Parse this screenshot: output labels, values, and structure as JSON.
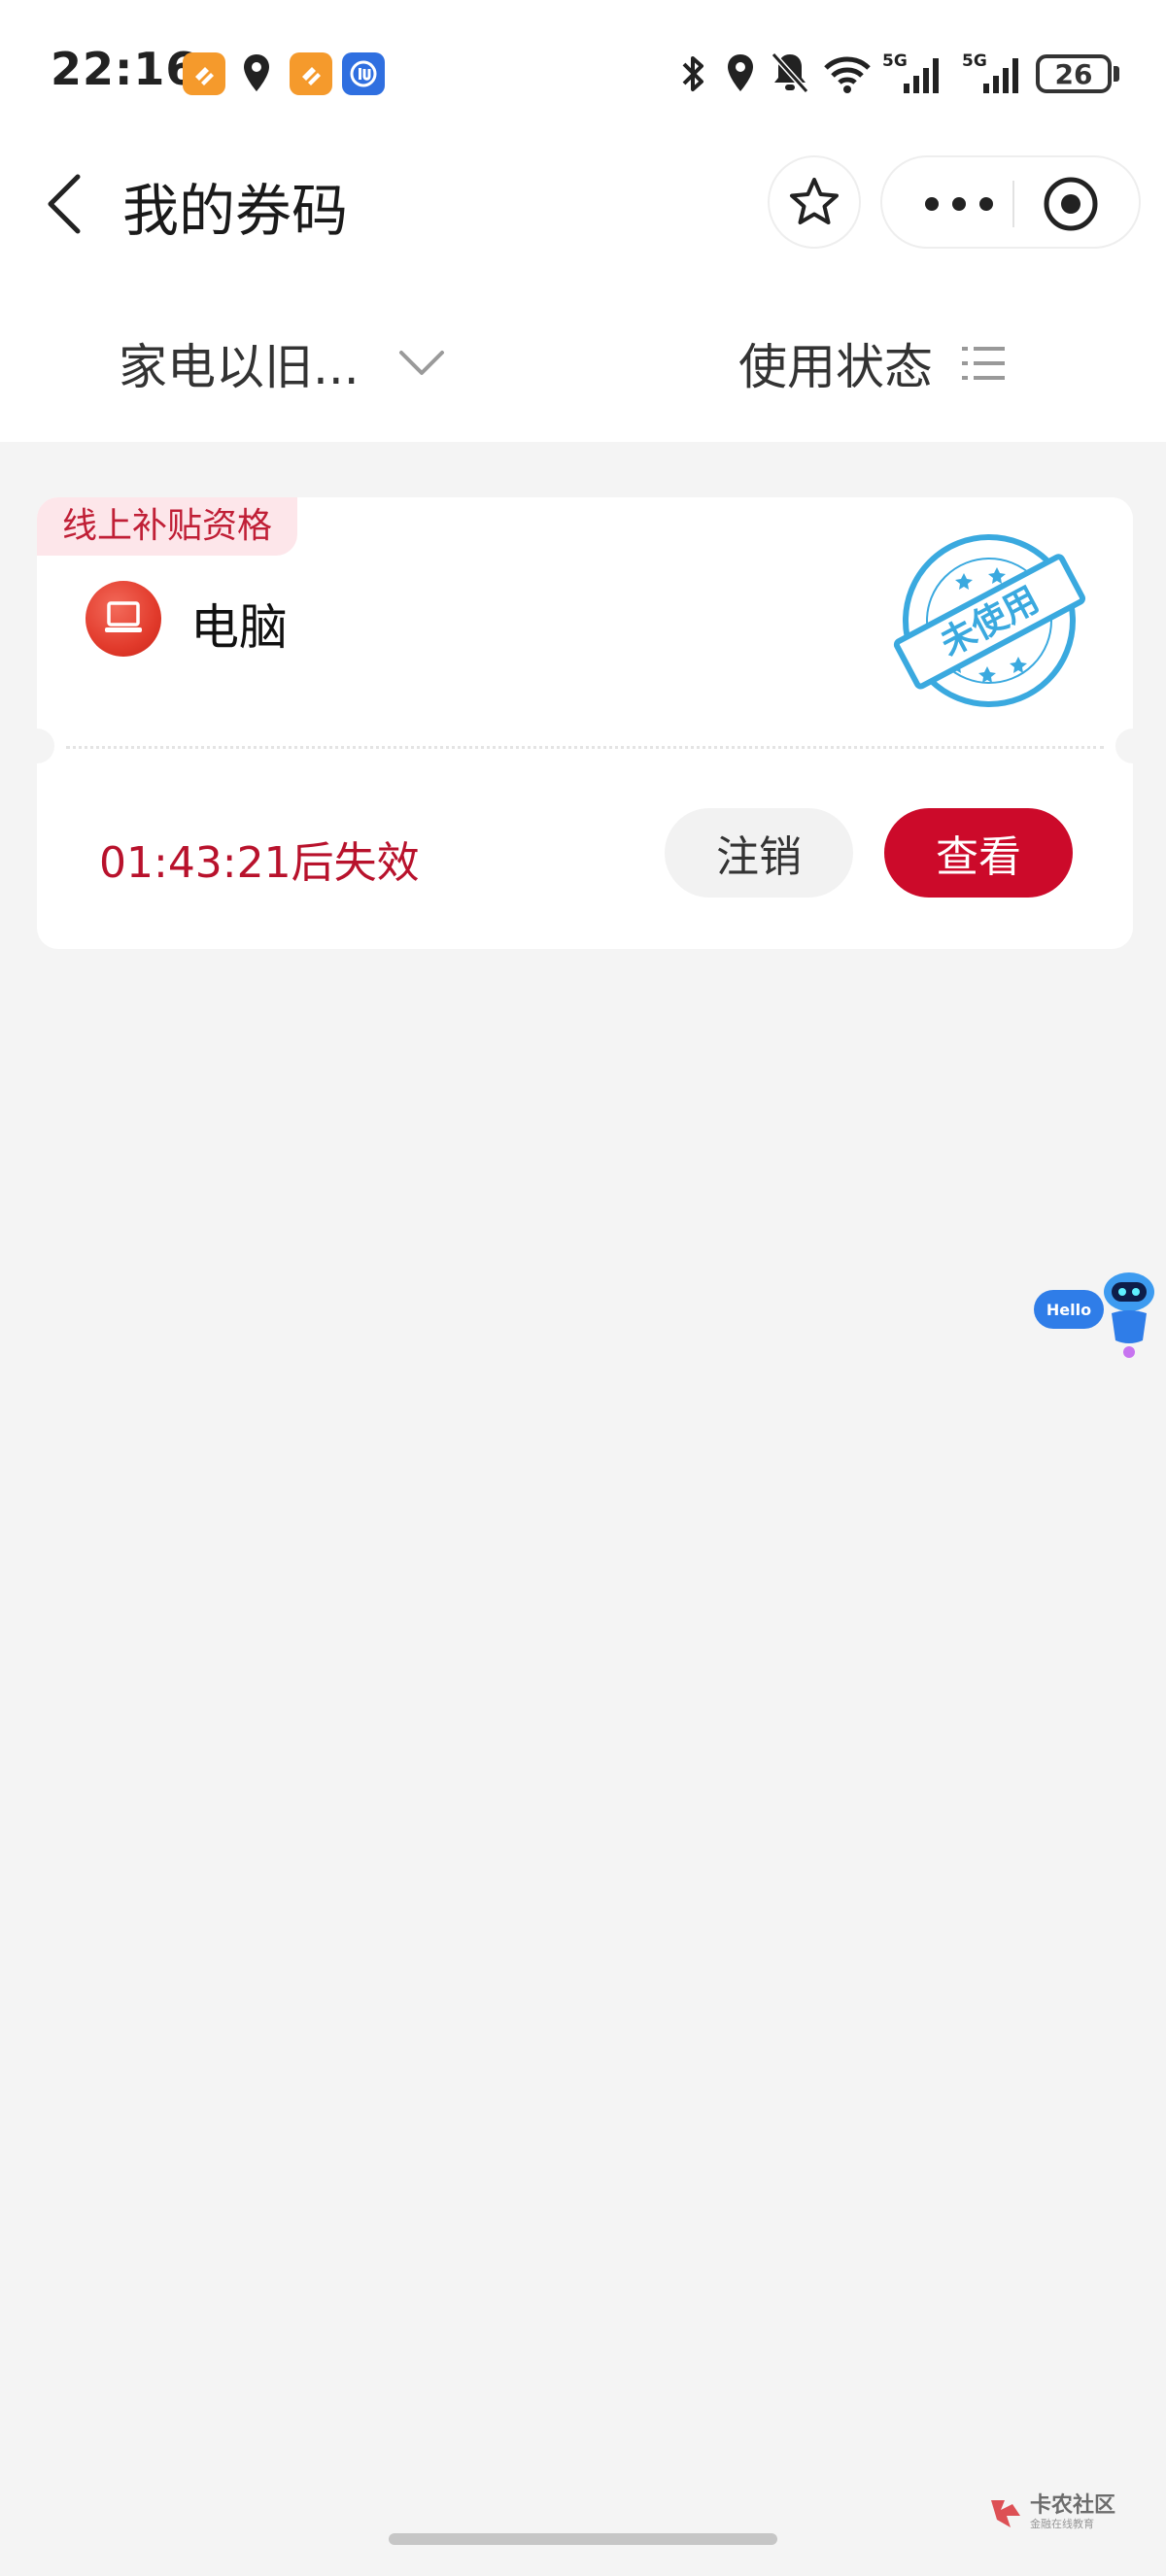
{
  "status_bar": {
    "time": "22:16",
    "battery": "26",
    "network": [
      "5G",
      "5G"
    ],
    "left_icons": [
      "orange-app-icon",
      "location-icon",
      "orange-app-icon",
      "blue-app-icon"
    ],
    "right_icons": [
      "bluetooth-icon",
      "location-icon",
      "mute-icon",
      "wifi-icon",
      "signal-icon",
      "signal-icon",
      "battery-icon"
    ]
  },
  "nav": {
    "title": "我的券码",
    "icons": [
      "back-icon",
      "star-icon",
      "more-icon",
      "close-target-icon"
    ]
  },
  "filters": {
    "category": "家电以旧...",
    "status": "使用状态"
  },
  "coupons": [
    {
      "tag": "线上补贴资格",
      "product": "电脑",
      "stamp": "未使用",
      "countdown": "01:43:21后失效",
      "cancel_label": "注销",
      "view_label": "查看"
    }
  ],
  "floating_assistant": {
    "bubble": "Hello"
  },
  "watermark": {
    "title": "卡农社区",
    "subtitle": "金融在线教育"
  },
  "colors": {
    "accent": "#cc0a2a",
    "tag_bg": "#fde6ea",
    "stamp": "#3aa9df",
    "background": "#f4f4f4"
  }
}
